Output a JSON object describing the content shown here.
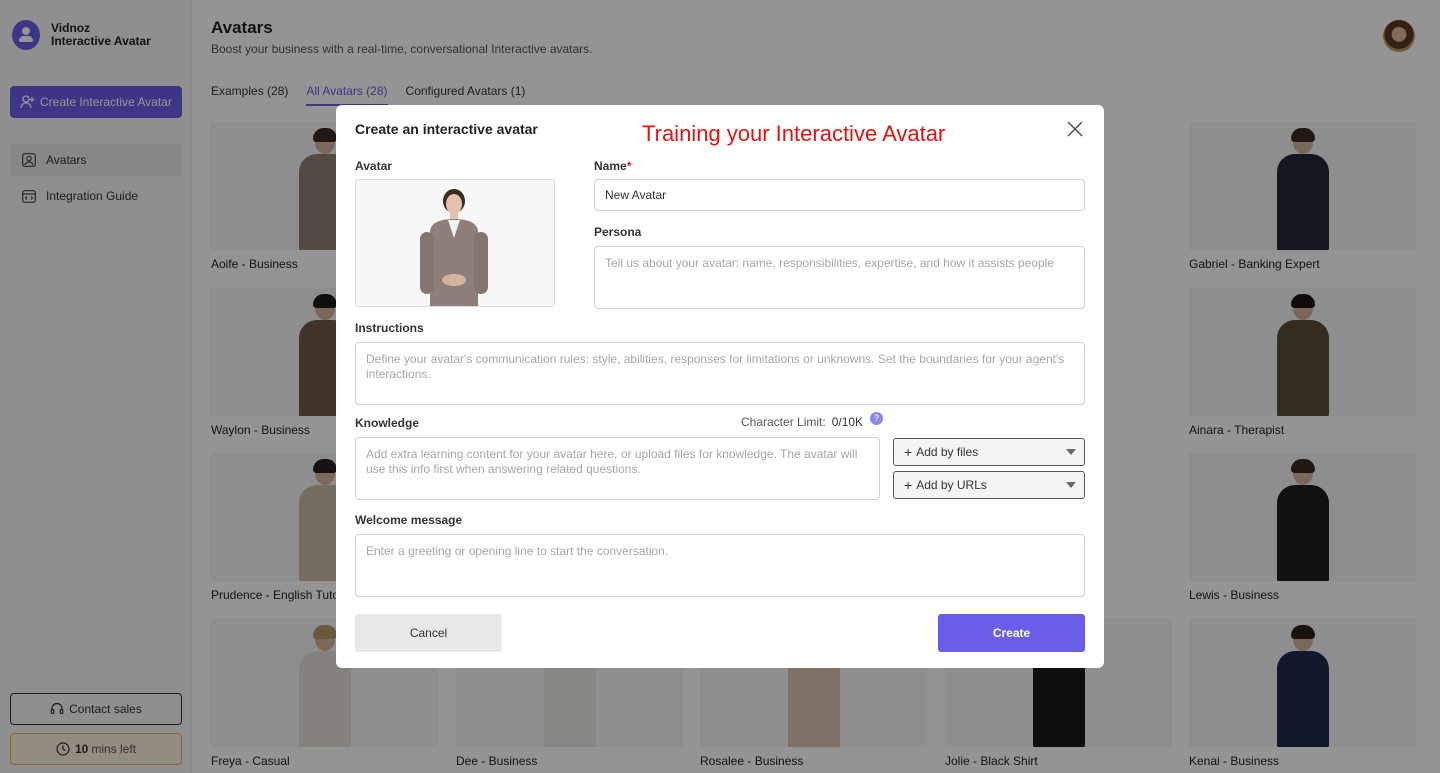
{
  "app": {
    "name_line1": "Vidnoz",
    "name_line2": "Interactive Avatar"
  },
  "sidebar": {
    "create_label": "Create Interactive Avatar",
    "items": [
      {
        "label": "Avatars",
        "icon": "person-square-icon",
        "active": true
      },
      {
        "label": "Integration Guide",
        "icon": "code-window-icon",
        "active": false
      }
    ],
    "contact_label": "Contact sales",
    "mins_value": "10",
    "mins_suffix": "mins left"
  },
  "header": {
    "title": "Avatars",
    "subtitle": "Boost your business with a real-time, conversational Interactive avatars."
  },
  "tabs": [
    {
      "label": "Examples (28)",
      "active": false
    },
    {
      "label": "All Avatars (28)",
      "active": true
    },
    {
      "label": "Configured Avatars (1)",
      "active": false
    }
  ],
  "avatars": [
    {
      "name": "Aoife - Business"
    },
    {
      "name": "Gabriel - Banking Expert"
    },
    {
      "name": "Waylon - Business"
    },
    {
      "name": "Ainara - Therapist"
    },
    {
      "name": "Prudence - English Tutor"
    },
    {
      "name": "Lewis - Business"
    },
    {
      "name": "Freya - Casual"
    },
    {
      "name": "Dee - Business"
    },
    {
      "name": "Rosalee - Business"
    },
    {
      "name": "Jolie - Black Shirt"
    },
    {
      "name": "Kenai - Business"
    }
  ],
  "modal": {
    "title": "Create an interactive avatar",
    "annotation": "Training your Interactive Avatar",
    "avatar_label": "Avatar",
    "name_label": "Name",
    "name_required": "*",
    "name_value": "New Avatar",
    "persona_label": "Persona",
    "persona_placeholder": "Tell us about your avatar: name, responsibilities, expertise, and how it assists people",
    "instructions_label": "Instructions",
    "instructions_placeholder": "Define your avatar's communication rules: style, abilities, responses for limitations or unknowns. Set the boundaries for your agent's interactions.",
    "knowledge_label": "Knowledge",
    "char_limit_label": "Character Limit:",
    "char_limit_value": "0/10K",
    "help_glyph": "?",
    "knowledge_placeholder": "Add extra learning content for your avatar here, or upload files for knowledge. The avatar will use this info first when answering related questions.",
    "add_files_label": "Add by files",
    "add_urls_label": "Add by URLs",
    "welcome_label": "Welcome message",
    "welcome_placeholder": "Enter a greeting or opening line to start the conversation.",
    "cancel_label": "Cancel",
    "create_label": "Create"
  },
  "colors": {
    "accent": "#6a5de8",
    "required": "#e51212",
    "annotation": "#e51212"
  }
}
